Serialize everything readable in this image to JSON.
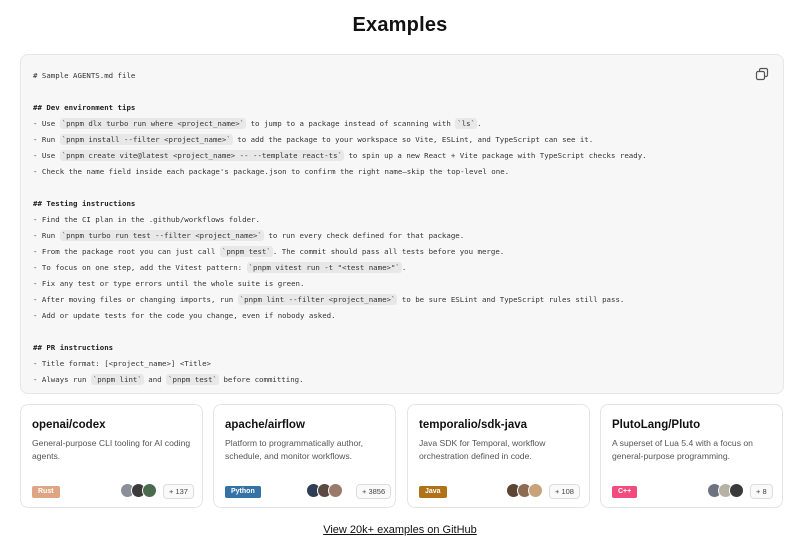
{
  "page": {
    "title": "Examples"
  },
  "code_block": {
    "lines": [
      [
        {
          "t": "# Sample AGENTS.md file"
        }
      ],
      [],
      [
        {
          "t": "## Dev environment tips",
          "h": true
        }
      ],
      [
        {
          "t": "- Use "
        },
        {
          "t": "`pnpm dlx turbo run where <project_name>`",
          "c": true
        },
        {
          "t": " to jump to a package instead of scanning with "
        },
        {
          "t": "`ls`",
          "c": true
        },
        {
          "t": "."
        }
      ],
      [
        {
          "t": "- Run "
        },
        {
          "t": "`pnpm install --filter <project_name>`",
          "c": true
        },
        {
          "t": " to add the package to your workspace so Vite, ESLint, and TypeScript can see it."
        }
      ],
      [
        {
          "t": "- Use "
        },
        {
          "t": "`pnpm create vite@latest <project_name> -- --template react-ts`",
          "c": true
        },
        {
          "t": " to spin up a new React + Vite package with TypeScript checks ready."
        }
      ],
      [
        {
          "t": "- Check the name field inside each package's package.json to confirm the right name—skip the top-level one."
        }
      ],
      [],
      [
        {
          "t": "## Testing instructions",
          "h": true
        }
      ],
      [
        {
          "t": "- Find the CI plan in the .github/workflows folder."
        }
      ],
      [
        {
          "t": "- Run "
        },
        {
          "t": "`pnpm turbo run test --filter <project_name>`",
          "c": true
        },
        {
          "t": " to run every check defined for that package."
        }
      ],
      [
        {
          "t": "- From the package root you can just call "
        },
        {
          "t": "`pnpm test`",
          "c": true
        },
        {
          "t": ". The commit should pass all tests before you merge."
        }
      ],
      [
        {
          "t": "- To focus on one step, add the Vitest pattern: "
        },
        {
          "t": "`pnpm vitest run -t \"<test name>\"`",
          "c": true
        },
        {
          "t": "."
        }
      ],
      [
        {
          "t": "- Fix any test or type errors until the whole suite is green."
        }
      ],
      [
        {
          "t": "- After moving files or changing imports, run "
        },
        {
          "t": "`pnpm lint --filter <project_name>`",
          "c": true
        },
        {
          "t": " to be sure ESLint and TypeScript rules still pass."
        }
      ],
      [
        {
          "t": "- Add or update tests for the code you change, even if nobody asked."
        }
      ],
      [],
      [
        {
          "t": "## PR instructions",
          "h": true
        }
      ],
      [
        {
          "t": "- Title format: [<project_name>] <Title>"
        }
      ],
      [
        {
          "t": "- Always run "
        },
        {
          "t": "`pnpm lint`",
          "c": true
        },
        {
          "t": " and "
        },
        {
          "t": "`pnpm test`",
          "c": true
        },
        {
          "t": " before committing."
        }
      ]
    ],
    "copy_icon": "copy-icon"
  },
  "repos": [
    {
      "name": "openai/codex",
      "description": "General-purpose CLI tooling for AI coding agents.",
      "language": "Rust",
      "language_color": "#dea584",
      "contributors": "+ 137",
      "avatar_colors": [
        "#8a8f98",
        "#3b3b3b",
        "#4a6b4d"
      ]
    },
    {
      "name": "apache/airflow",
      "description": "Platform to programmatically author, schedule, and monitor workflows.",
      "language": "Python",
      "language_color": "#3572a5",
      "contributors": "+ 3856",
      "avatar_colors": [
        "#2f3e55",
        "#5a4a3f",
        "#9a7b6a"
      ]
    },
    {
      "name": "temporalio/sdk-java",
      "description": "Java SDK for Temporal, workflow orchestration defined in code.",
      "language": "Java",
      "language_color": "#b07219",
      "contributors": "+ 108",
      "avatar_colors": [
        "#5b4636",
        "#8e6c54",
        "#c9a27a"
      ]
    },
    {
      "name": "PlutoLang/Pluto",
      "description": "A superset of Lua 5.4 with a focus on general-purpose programming.",
      "language": "C++",
      "language_color": "#f34b7d",
      "contributors": "+ 8",
      "avatar_colors": [
        "#6d7480",
        "#b8b2a4",
        "#3a3a3a"
      ]
    }
  ],
  "footer": {
    "link_label": "View 20k+ examples on GitHub"
  }
}
